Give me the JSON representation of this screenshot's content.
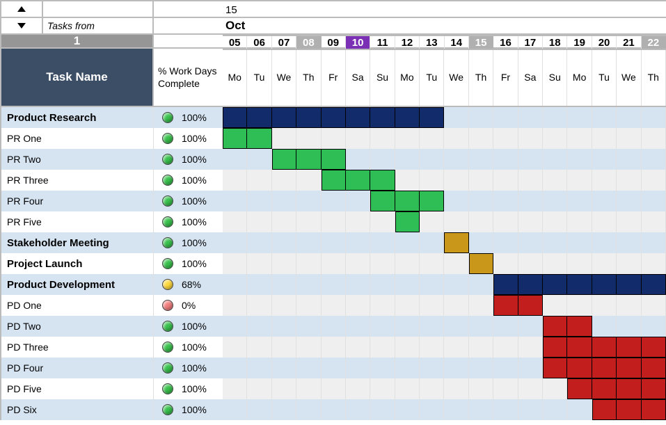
{
  "header": {
    "tasks_from_label": "Tasks from",
    "counter": "1",
    "top_number": "15",
    "month_label": "Oct",
    "task_col_label": "Task Name",
    "pct_col_label_line1": "% Work Days",
    "pct_col_label_line2": "Complete"
  },
  "chart_data": {
    "type": "gantt",
    "title": "",
    "days": [
      {
        "num": "05",
        "dow": "Mo",
        "flag": ""
      },
      {
        "num": "06",
        "dow": "Tu",
        "flag": ""
      },
      {
        "num": "07",
        "dow": "We",
        "flag": ""
      },
      {
        "num": "08",
        "dow": "Th",
        "flag": "weekend"
      },
      {
        "num": "09",
        "dow": "Fr",
        "flag": ""
      },
      {
        "num": "10",
        "dow": "Sa",
        "flag": "today"
      },
      {
        "num": "11",
        "dow": "Su",
        "flag": ""
      },
      {
        "num": "12",
        "dow": "Mo",
        "flag": ""
      },
      {
        "num": "13",
        "dow": "Tu",
        "flag": ""
      },
      {
        "num": "14",
        "dow": "We",
        "flag": ""
      },
      {
        "num": "15",
        "dow": "Th",
        "flag": "weekend"
      },
      {
        "num": "16",
        "dow": "Fr",
        "flag": ""
      },
      {
        "num": "17",
        "dow": "Sa",
        "flag": ""
      },
      {
        "num": "18",
        "dow": "Su",
        "flag": ""
      },
      {
        "num": "19",
        "dow": "Mo",
        "flag": ""
      },
      {
        "num": "20",
        "dow": "Tu",
        "flag": ""
      },
      {
        "num": "21",
        "dow": "We",
        "flag": ""
      },
      {
        "num": "22",
        "dow": "Th",
        "flag": "weekend"
      }
    ],
    "tasks": [
      {
        "name": "Product Research",
        "bold": true,
        "ball": "green",
        "pct": "100%",
        "start": 0,
        "end": 9,
        "color": "navy"
      },
      {
        "name": "PR One",
        "bold": false,
        "ball": "green",
        "pct": "100%",
        "start": 0,
        "end": 2,
        "color": "green"
      },
      {
        "name": "PR Two",
        "bold": false,
        "ball": "green",
        "pct": "100%",
        "start": 2,
        "end": 5,
        "color": "green"
      },
      {
        "name": "PR Three",
        "bold": false,
        "ball": "green",
        "pct": "100%",
        "start": 4,
        "end": 7,
        "color": "green"
      },
      {
        "name": "PR Four",
        "bold": false,
        "ball": "green",
        "pct": "100%",
        "start": 6,
        "end": 9,
        "color": "green"
      },
      {
        "name": "PR Five",
        "bold": false,
        "ball": "green",
        "pct": "100%",
        "start": 7,
        "end": 8,
        "color": "green"
      },
      {
        "name": "Stakeholder Meeting",
        "bold": true,
        "ball": "green",
        "pct": "100%",
        "start": 9,
        "end": 10,
        "color": "gold"
      },
      {
        "name": "Project Launch",
        "bold": true,
        "ball": "green",
        "pct": "100%",
        "start": 10,
        "end": 11,
        "color": "gold"
      },
      {
        "name": "Product Development",
        "bold": true,
        "ball": "yellow",
        "pct": "68%",
        "start": 11,
        "end": 18,
        "color": "navy"
      },
      {
        "name": "PD One",
        "bold": false,
        "ball": "red",
        "pct": "0%",
        "start": 11,
        "end": 13,
        "color": "red"
      },
      {
        "name": "PD Two",
        "bold": false,
        "ball": "green",
        "pct": "100%",
        "start": 13,
        "end": 15,
        "color": "red"
      },
      {
        "name": "PD Three",
        "bold": false,
        "ball": "green",
        "pct": "100%",
        "start": 13,
        "end": 18,
        "color": "red"
      },
      {
        "name": "PD Four",
        "bold": false,
        "ball": "green",
        "pct": "100%",
        "start": 13,
        "end": 18,
        "color": "red"
      },
      {
        "name": "PD Five",
        "bold": false,
        "ball": "green",
        "pct": "100%",
        "start": 14,
        "end": 18,
        "color": "red"
      },
      {
        "name": "PD Six",
        "bold": false,
        "ball": "green",
        "pct": "100%",
        "start": 15,
        "end": 18,
        "color": "red"
      }
    ]
  }
}
